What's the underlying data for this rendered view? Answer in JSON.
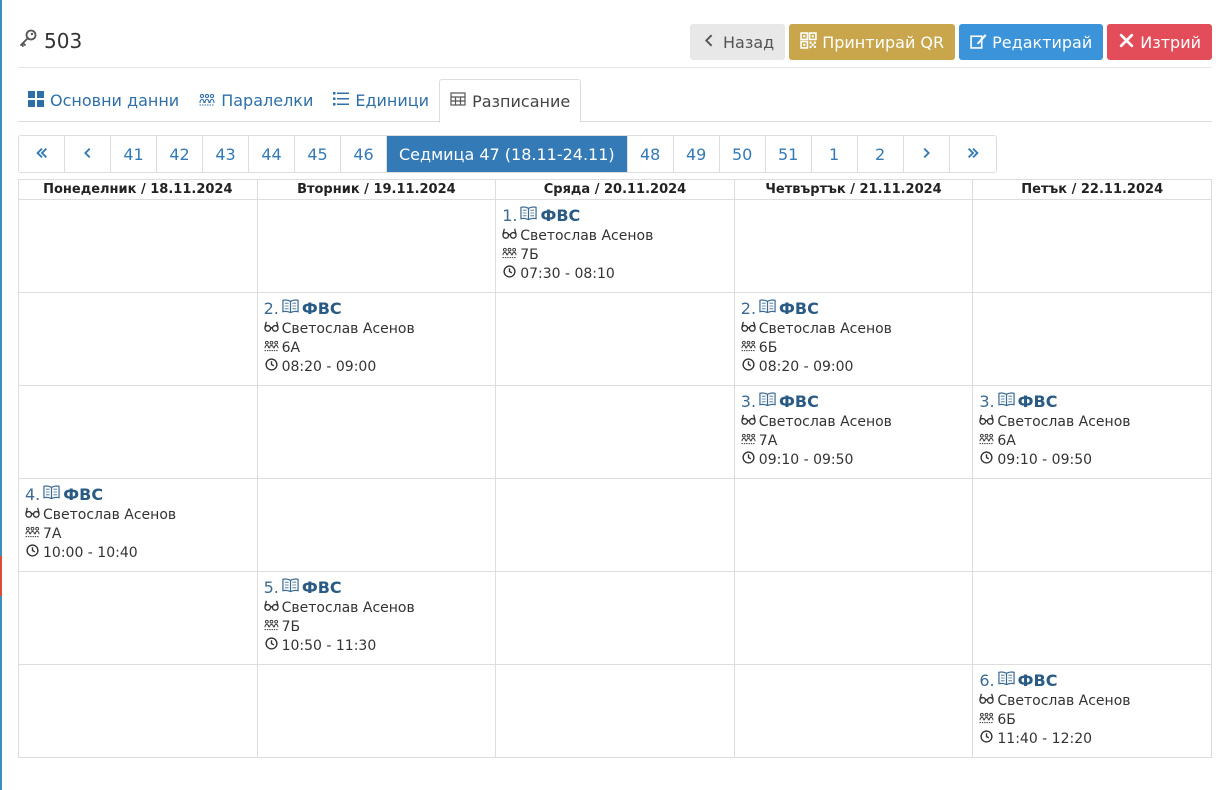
{
  "header": {
    "title": "503",
    "title_icon": "key-icon",
    "buttons": {
      "back": "Назад",
      "print_qr": "Принтирай QR",
      "edit": "Редактирай",
      "delete": "Изтрий"
    }
  },
  "tabs": [
    {
      "label": "Основни данни",
      "icon": "grid-icon"
    },
    {
      "label": "Паралелки",
      "icon": "group-icon"
    },
    {
      "label": "Единици",
      "icon": "list-icon"
    },
    {
      "label": "Разписание",
      "icon": "table-icon",
      "active": true
    }
  ],
  "pager": {
    "weeks_before": [
      "41",
      "42",
      "43",
      "44",
      "45",
      "46"
    ],
    "current": "Седмица 47 (18.11-24.11)",
    "weeks_after": [
      "48",
      "49",
      "50",
      "51",
      "1",
      "2"
    ]
  },
  "schedule": {
    "days": [
      "Понеделник / 18.11.2024",
      "Вторник / 19.11.2024",
      "Сряда / 20.11.2024",
      "Четвъртък / 21.11.2024",
      "Петък / 22.11.2024"
    ],
    "rows": [
      [
        null,
        null,
        {
          "num": "1.",
          "subject": "ФВС",
          "teacher": "Светослав Асенов",
          "class": "7Б",
          "time": "07:30 - 08:10"
        },
        null,
        null
      ],
      [
        null,
        {
          "num": "2.",
          "subject": "ФВС",
          "teacher": "Светослав Асенов",
          "class": "6А",
          "time": "08:20 - 09:00"
        },
        null,
        {
          "num": "2.",
          "subject": "ФВС",
          "teacher": "Светослав Асенов",
          "class": "6Б",
          "time": "08:20 - 09:00"
        },
        null
      ],
      [
        null,
        null,
        null,
        {
          "num": "3.",
          "subject": "ФВС",
          "teacher": "Светослав Асенов",
          "class": "7А",
          "time": "09:10 - 09:50"
        },
        {
          "num": "3.",
          "subject": "ФВС",
          "teacher": "Светослав Асенов",
          "class": "6А",
          "time": "09:10 - 09:50"
        }
      ],
      [
        {
          "num": "4.",
          "subject": "ФВС",
          "teacher": "Светослав Асенов",
          "class": "7А",
          "time": "10:00 - 10:40"
        },
        null,
        null,
        null,
        null
      ],
      [
        null,
        {
          "num": "5.",
          "subject": "ФВС",
          "teacher": "Светослав Асенов",
          "class": "7Б",
          "time": "10:50 - 11:30"
        },
        null,
        null,
        null
      ],
      [
        null,
        null,
        null,
        null,
        {
          "num": "6.",
          "subject": "ФВС",
          "teacher": "Светослав Асенов",
          "class": "6Б",
          "time": "11:40 - 12:20"
        }
      ]
    ]
  }
}
